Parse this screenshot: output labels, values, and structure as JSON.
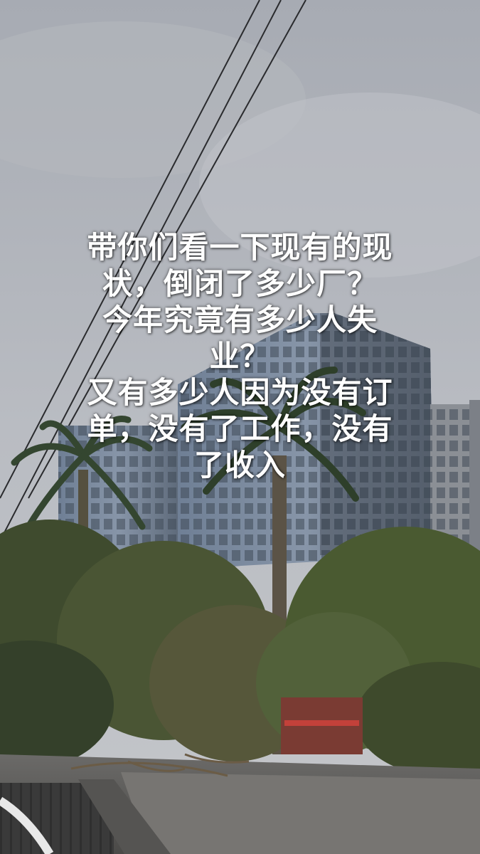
{
  "caption": {
    "lines": [
      "带你们看一下现有的现",
      "状，倒闭了多少厂？",
      "今年究竟有多少人失",
      "业？",
      "又有多少人因为没有订",
      "单，没有了工作，没有",
      "了收入"
    ]
  }
}
